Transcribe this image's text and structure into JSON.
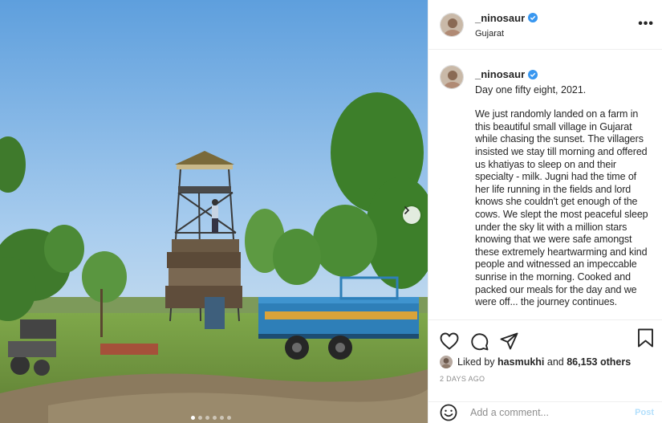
{
  "colors": {
    "accent": "#0095f6",
    "accent_disabled": "#b2dffc",
    "text": "#262626",
    "muted": "#8e8e8e",
    "divider": "#efefef",
    "verified": "#3897f0"
  },
  "post": {
    "photo_icons": {
      "next": "chevron-right-icon"
    },
    "carousel": {
      "count": 6,
      "active_index": 0
    }
  },
  "header": {
    "username": "_ninosaur",
    "location": "Gujarat",
    "more_icon": "more-horizontal-icon"
  },
  "caption": {
    "username": "_ninosaur",
    "title": "Day one fifty eight, 2021.",
    "text": "We just randomly landed on a farm in this beautiful small village in Gujarat while chasing the sunset. The villagers insisted we stay till morning and offered us khatiyas to sleep on and their specialty - milk. Jugni had the time of her life running in the fields and lord knows she couldn't get enough of the cows. We slept the most peaceful sleep under the sky lit with a million stars knowing that we were safe amongst these extremely heartwarming and kind people and witnessed an impeccable sunrise in the morning. Cooked and packed our meals for the day and we were off... the journey continues."
  },
  "actions": {
    "icons": [
      "heart-icon",
      "comment-icon",
      "share-icon",
      "bookmark-icon"
    ],
    "likes_prefix": "Liked by",
    "likes_user": "hasmukhi",
    "likes_joiner": "and",
    "likes_count": "86,153 others",
    "date": "2 DAYS AGO"
  },
  "comment": {
    "placeholder": "Add a comment...",
    "post_label": "Post"
  }
}
